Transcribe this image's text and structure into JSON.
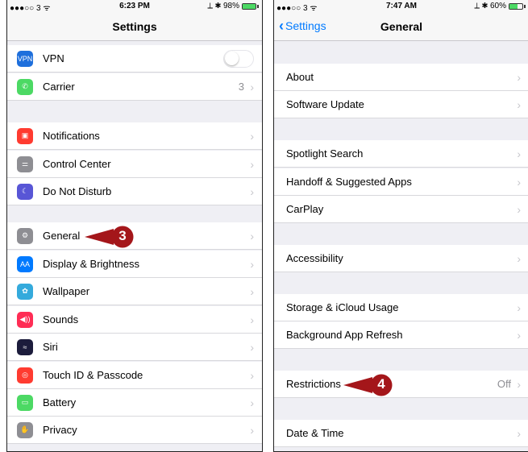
{
  "left_screen": {
    "status": {
      "carrier": "●●●○○ 3 ᯤ",
      "time": "6:23 PM",
      "battery_text": "⟂ ✱ 98%",
      "battery_level": 0.98
    },
    "nav": {
      "title": "Settings"
    },
    "rows": [
      {
        "label": "VPN",
        "icon": "vpn-icon",
        "icon_text": "VPN",
        "color": "#1e6fdc",
        "accessory": "toggle",
        "toggle_on": false
      },
      {
        "label": "Carrier",
        "icon": "phone-icon",
        "icon_text": "✆",
        "color": "#4cd964",
        "value": "3"
      },
      {
        "label": "Notifications",
        "icon": "notifications-icon",
        "icon_text": "▣",
        "color": "#ff3b30"
      },
      {
        "label": "Control Center",
        "icon": "control-center-icon",
        "icon_text": "⚌",
        "color": "#8e8e93"
      },
      {
        "label": "Do Not Disturb",
        "icon": "moon-icon",
        "icon_text": "☾",
        "color": "#5856d6"
      },
      {
        "label": "General",
        "icon": "gear-icon",
        "icon_text": "⚙",
        "color": "#8e8e93"
      },
      {
        "label": "Display & Brightness",
        "icon": "display-icon",
        "icon_text": "AA",
        "color": "#007aff"
      },
      {
        "label": "Wallpaper",
        "icon": "wallpaper-icon",
        "icon_text": "✿",
        "color": "#34aadc"
      },
      {
        "label": "Sounds",
        "icon": "sound-icon",
        "icon_text": "◀))",
        "color": "#ff2d55"
      },
      {
        "label": "Siri",
        "icon": "siri-icon",
        "icon_text": "≈",
        "color": "#1c1c3c"
      },
      {
        "label": "Touch ID & Passcode",
        "icon": "fingerprint-icon",
        "icon_text": "◎",
        "color": "#ff3b30"
      },
      {
        "label": "Battery",
        "icon": "battery-icon",
        "icon_text": "▭",
        "color": "#4cd964"
      },
      {
        "label": "Privacy",
        "icon": "hand-icon",
        "icon_text": "✋",
        "color": "#8e8e93"
      }
    ],
    "callout": {
      "number": "3",
      "color": "#a4161a"
    }
  },
  "right_screen": {
    "status": {
      "carrier": "●●●○○ 3 ᯤ",
      "time": "7:47 AM",
      "battery_text": "⟂ ✱ 60%",
      "battery_level": 0.6
    },
    "nav": {
      "title": "General",
      "back_label": "Settings"
    },
    "rows": [
      {
        "label": "About"
      },
      {
        "label": "Software Update"
      },
      {
        "label": "Spotlight Search"
      },
      {
        "label": "Handoff & Suggested Apps"
      },
      {
        "label": "CarPlay"
      },
      {
        "label": "Accessibility"
      },
      {
        "label": "Storage & iCloud Usage"
      },
      {
        "label": "Background App Refresh"
      },
      {
        "label": "Restrictions",
        "value": "Off"
      },
      {
        "label": "Date & Time"
      }
    ],
    "callout": {
      "number": "4",
      "color": "#a4161a"
    }
  },
  "chevron_char": "›"
}
